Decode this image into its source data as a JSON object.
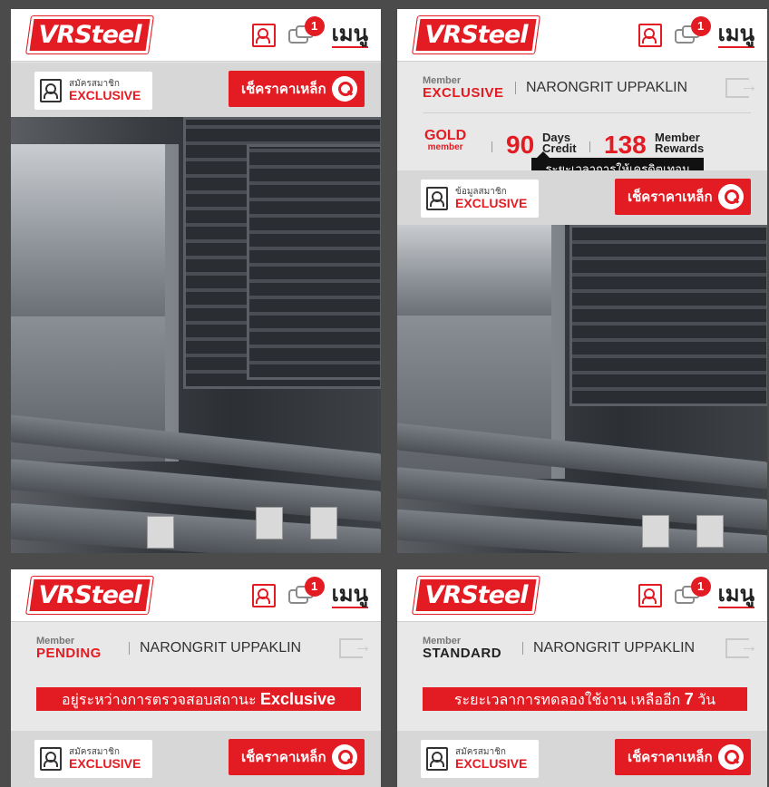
{
  "brand": {
    "logo_text": "VRSteel",
    "accent": "#e31b23"
  },
  "header": {
    "notification_count": "1",
    "menu_label": "เมนู"
  },
  "exclusive_badge": {
    "signup_small": "สมัครสมาชิก",
    "member_info_small": "ข้อมูลสมาชิก",
    "large": "EXCLUSIVE"
  },
  "check_price_button": "เช็คราคาเหล็ก",
  "user": {
    "name": "NARONGRIT UPPAKLIN"
  },
  "member_label": "Member",
  "panels": {
    "exclusive": {
      "tier": "EXCLUSIVE",
      "gold_large": "GOLD",
      "gold_small": "member",
      "days_value": "90",
      "days_label_1": "Days",
      "days_label_2": "Credit",
      "rewards_value": "138",
      "rewards_label_1": "Member",
      "rewards_label_2": "Rewards",
      "tooltip": "ระยะเวลาการให้เครดิตเทอม"
    },
    "pending": {
      "tier": "PENDING",
      "banner_text": "อยู่ระหว่างการตรวจสอบสถานะ ",
      "banner_bold": "Exclusive"
    },
    "standard": {
      "tier": "STANDARD",
      "banner_text": "ระยะเวลาการทดลองใช้งาน เหลืออีก ",
      "banner_days": "7",
      "banner_suffix": " วัน"
    }
  }
}
